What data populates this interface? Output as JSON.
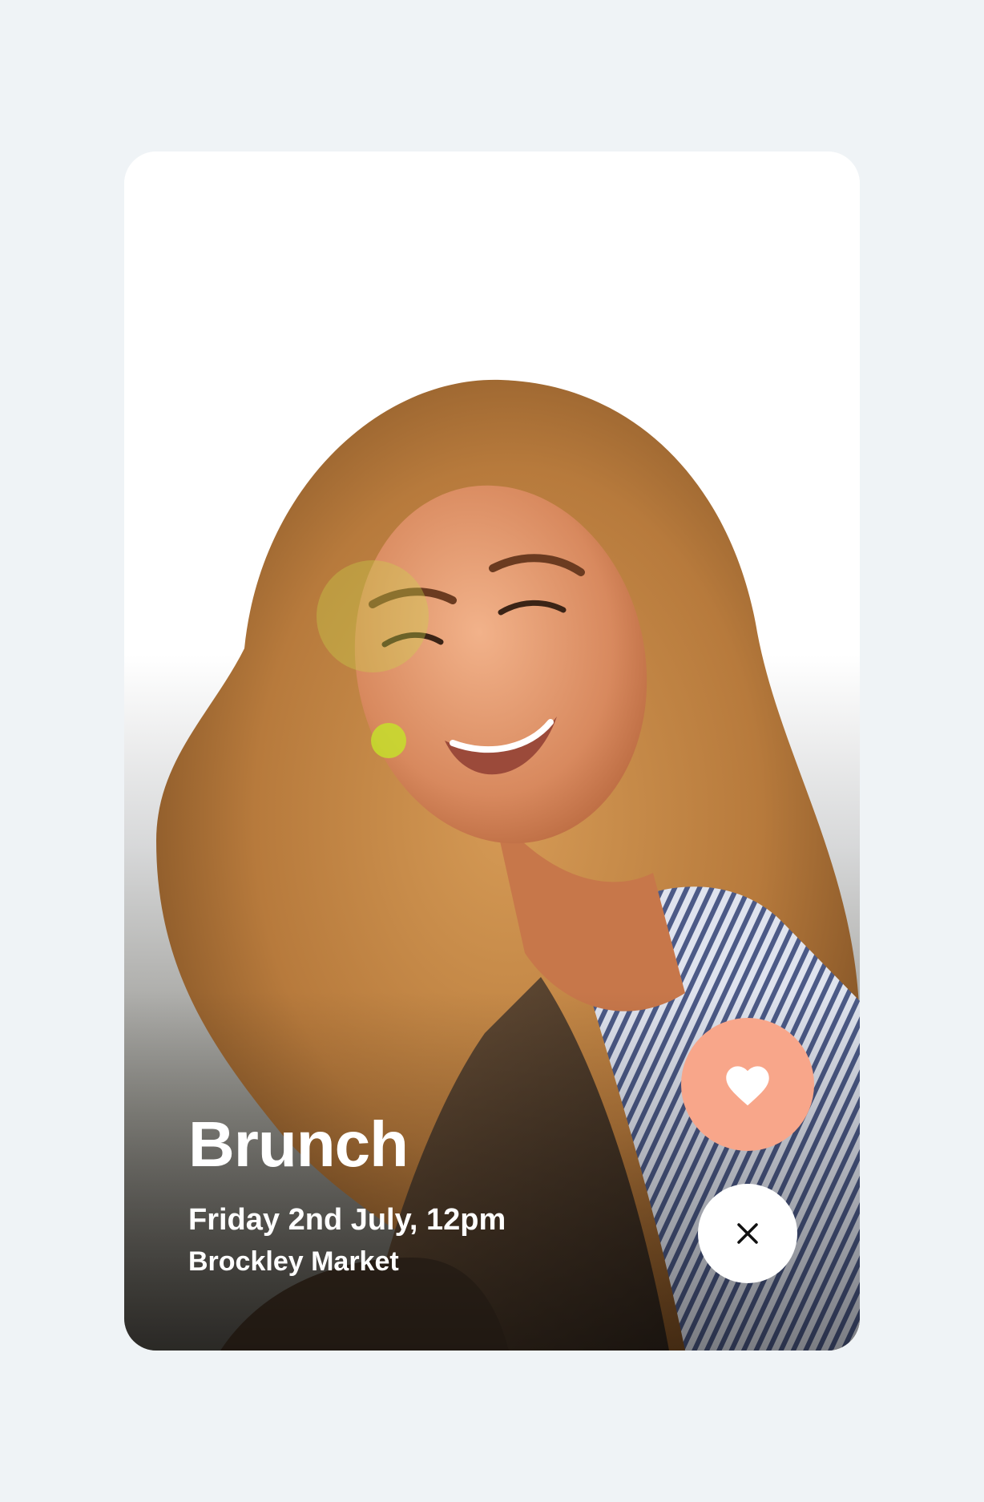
{
  "event": {
    "title": "Brunch",
    "datetime": "Friday 2nd July, 12pm",
    "location": "Brockley Market"
  },
  "actions": {
    "like_icon": "heart-icon",
    "dismiss_icon": "close-icon"
  },
  "colors": {
    "page_background": "#eff3f6",
    "like_button": "#f8a68a",
    "dismiss_button": "#ffffff"
  }
}
